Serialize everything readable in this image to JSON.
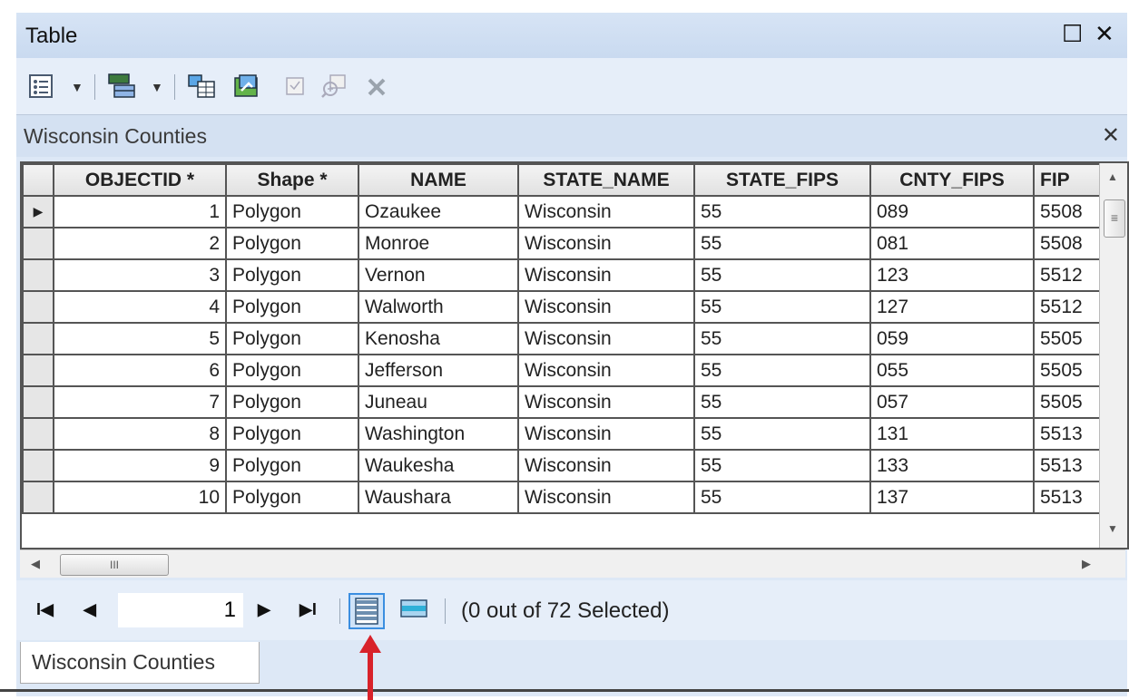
{
  "window": {
    "title": "Table",
    "restore_glyph": "☐",
    "close_glyph": "✕"
  },
  "toolbar": {
    "icons": [
      "table-options-icon",
      "related-tables-icon",
      "select-by-attributes-icon",
      "switch-selection-icon",
      "clear-selection-icon",
      "zoom-to-selected-icon",
      "delete-selected-icon"
    ]
  },
  "panel": {
    "title": "Wisconsin Counties",
    "close_glyph": "✕"
  },
  "table": {
    "columns": [
      "OBJECTID *",
      "Shape *",
      "NAME",
      "STATE_NAME",
      "STATE_FIPS",
      "CNTY_FIPS",
      "FIP"
    ],
    "rows": [
      [
        "1",
        "Polygon",
        "Ozaukee",
        "Wisconsin",
        "55",
        "089",
        "5508"
      ],
      [
        "2",
        "Polygon",
        "Monroe",
        "Wisconsin",
        "55",
        "081",
        "5508"
      ],
      [
        "3",
        "Polygon",
        "Vernon",
        "Wisconsin",
        "55",
        "123",
        "5512"
      ],
      [
        "4",
        "Polygon",
        "Walworth",
        "Wisconsin",
        "55",
        "127",
        "5512"
      ],
      [
        "5",
        "Polygon",
        "Kenosha",
        "Wisconsin",
        "55",
        "059",
        "5505"
      ],
      [
        "6",
        "Polygon",
        "Jefferson",
        "Wisconsin",
        "55",
        "055",
        "5505"
      ],
      [
        "7",
        "Polygon",
        "Juneau",
        "Wisconsin",
        "55",
        "057",
        "5505"
      ],
      [
        "8",
        "Polygon",
        "Washington",
        "Wisconsin",
        "55",
        "131",
        "5513"
      ],
      [
        "9",
        "Polygon",
        "Waukesha",
        "Wisconsin",
        "55",
        "133",
        "5513"
      ],
      [
        "10",
        "Polygon",
        "Waushara",
        "Wisconsin",
        "55",
        "137",
        "5513"
      ]
    ],
    "current_row_marker": "▶"
  },
  "scroll": {
    "h_thumb_grip": "III",
    "v_thumb_grip": "≡",
    "left": "◀",
    "right": "▶",
    "up": "▲",
    "down": "▼"
  },
  "nav": {
    "first": "I◀",
    "prev": "◀",
    "page": "1",
    "next": "▶",
    "last": "▶I",
    "status": "(0 out of 72 Selected)"
  },
  "tab": {
    "label": "Wisconsin Counties"
  },
  "colors": {
    "arrow": "#d8222a",
    "view_active_border": "#3b8ee0"
  }
}
